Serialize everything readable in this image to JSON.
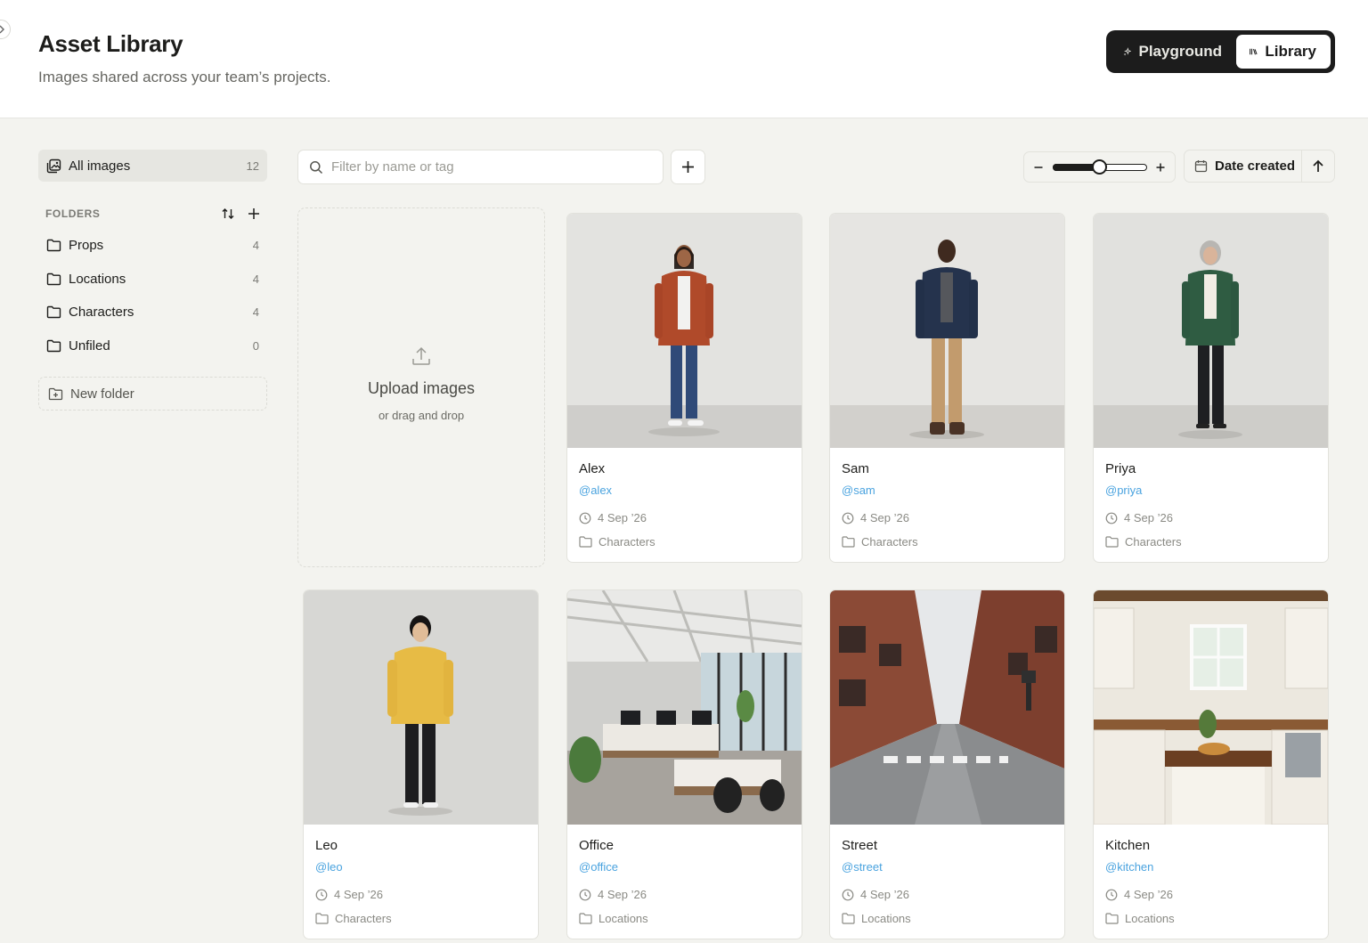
{
  "header": {
    "title": "Asset Library",
    "subtitle": "Images shared across your team’s projects.",
    "mode_switch": {
      "playground_label": "Playground",
      "library_label": "Library",
      "active": "Library"
    }
  },
  "sidebar": {
    "all_images": {
      "label": "All images",
      "count": "12"
    },
    "folders_heading": "FOLDERS",
    "folders": [
      {
        "label": "Props",
        "count": "4"
      },
      {
        "label": "Locations",
        "count": "4"
      },
      {
        "label": "Characters",
        "count": "4"
      },
      {
        "label": "Unfiled",
        "count": "0"
      }
    ],
    "new_folder_label": "New folder"
  },
  "toolbar": {
    "search_placeholder": "Filter by name or tag",
    "zoom_level": 0.5,
    "sort_field": "Date created",
    "sort_direction": "ascending"
  },
  "upload": {
    "title": "Upload images",
    "subtitle": "or drag and drop"
  },
  "assets": [
    {
      "name": "Alex",
      "handle": "@alex",
      "date": "4 Sep ’26",
      "folder": "Characters"
    },
    {
      "name": "Sam",
      "handle": "@sam",
      "date": "4 Sep ’26",
      "folder": "Characters"
    },
    {
      "name": "Priya",
      "handle": "@priya",
      "date": "4 Sep ’26",
      "folder": "Characters"
    },
    {
      "name": "Leo",
      "handle": "@leo",
      "date": "4 Sep ’26",
      "folder": "Characters"
    },
    {
      "name": "Office",
      "handle": "@office",
      "date": "4 Sep ’26",
      "folder": "Locations"
    },
    {
      "name": "Street",
      "handle": "@street",
      "date": "4 Sep ’26",
      "folder": "Locations"
    },
    {
      "name": "Kitchen",
      "handle": "@kitchen",
      "date": "4 Sep ’26",
      "folder": "Locations"
    }
  ],
  "colors": {
    "accent_link": "#4aa3df",
    "switch_bg": "#1c1c1c",
    "page_bg": "#f3f3ef"
  }
}
